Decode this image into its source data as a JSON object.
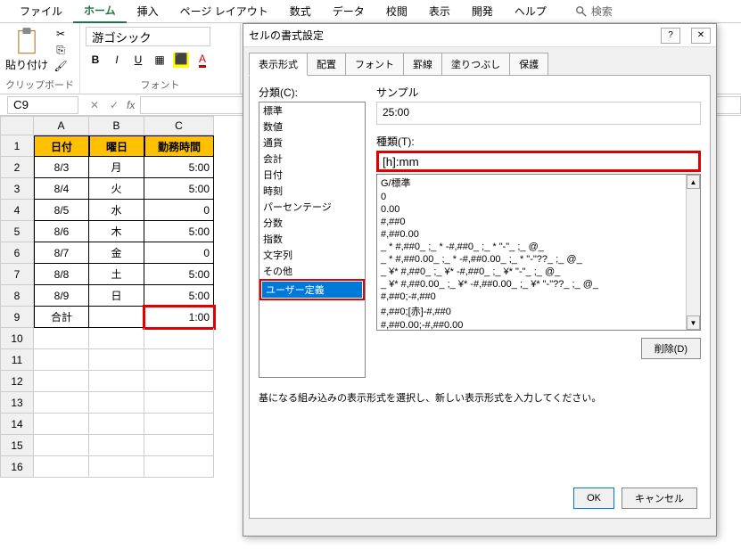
{
  "ribbon": {
    "tabs": [
      "ファイル",
      "ホーム",
      "挿入",
      "ページ レイアウト",
      "数式",
      "データ",
      "校閲",
      "表示",
      "開発",
      "ヘルプ"
    ],
    "active_tab": "ホーム",
    "search": "検索",
    "clipboard_label": "クリップボード",
    "paste_label": "貼り付け",
    "font_group_label": "フォント",
    "font_name": "游ゴシック"
  },
  "formula_bar": {
    "name_box": "C9",
    "fx": "fx",
    "formula": ""
  },
  "sheet": {
    "cols": [
      "A",
      "B",
      "C"
    ],
    "headers": {
      "A": "日付",
      "B": "曜日",
      "C": "勤務時間"
    },
    "rows": [
      {
        "n": 2,
        "A": "8/3",
        "B": "月",
        "C": "5:00"
      },
      {
        "n": 3,
        "A": "8/4",
        "B": "火",
        "C": "5:00"
      },
      {
        "n": 4,
        "A": "8/5",
        "B": "水",
        "C": "0"
      },
      {
        "n": 5,
        "A": "8/6",
        "B": "木",
        "C": "5:00"
      },
      {
        "n": 6,
        "A": "8/7",
        "B": "金",
        "C": "0"
      },
      {
        "n": 7,
        "A": "8/8",
        "B": "土",
        "C": "5:00"
      },
      {
        "n": 8,
        "A": "8/9",
        "B": "日",
        "C": "5:00"
      },
      {
        "n": 9,
        "A": "合計",
        "B": "",
        "C": "1:00",
        "selected": true
      }
    ],
    "empty_rows": [
      10,
      11,
      12,
      13,
      14,
      15,
      16
    ]
  },
  "dialog": {
    "title": "セルの書式設定",
    "help": "?",
    "close": "✕",
    "tabs": [
      "表示形式",
      "配置",
      "フォント",
      "罫線",
      "塗りつぶし",
      "保護"
    ],
    "active_tab": "表示形式",
    "category_label": "分類(C):",
    "categories": [
      "標準",
      "数値",
      "通貨",
      "会計",
      "日付",
      "時刻",
      "パーセンテージ",
      "分数",
      "指数",
      "文字列",
      "その他",
      "ユーザー定義"
    ],
    "selected_category": "ユーザー定義",
    "sample_label": "サンプル",
    "sample_value": "25:00",
    "type_label": "種類(T):",
    "type_value": "[h]:mm",
    "formats": [
      "G/標準",
      "0",
      "0.00",
      "#,##0",
      "#,##0.00",
      "_ * #,##0_ ;_ * -#,##0_ ;_ * \"-\"_ ;_ @_ ",
      "_ * #,##0.00_ ;_ * -#,##0.00_ ;_ * \"-\"??_ ;_ @_ ",
      "_ ¥* #,##0_ ;_ ¥* -#,##0_ ;_ ¥* \"-\"_ ;_ @_ ",
      "_ ¥* #,##0.00_ ;_ ¥* -#,##0.00_ ;_ ¥* \"-\"??_ ;_ @_ ",
      "#,##0;-#,##0",
      "#,##0;[赤]-#,##0",
      "#,##0.00;-#,##0.00"
    ],
    "delete_btn": "削除(D)",
    "hint": "基になる組み込みの表示形式を選択し、新しい表示形式を入力してください。",
    "ok": "OK",
    "cancel": "キャンセル"
  }
}
